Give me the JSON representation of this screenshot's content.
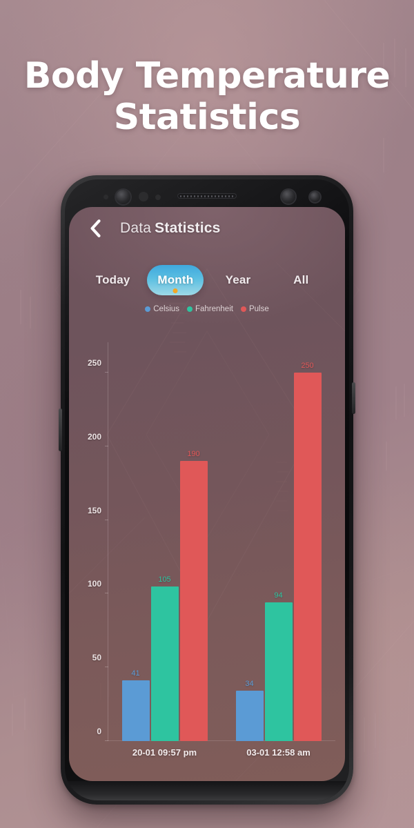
{
  "poster": {
    "title_line1": "Body Temperature",
    "title_line2": "Statistics"
  },
  "app": {
    "header": {
      "back_icon": "chevron-left-icon",
      "title_light": "Data",
      "title_bold": "Statistics"
    },
    "tabs": [
      {
        "label": "Today",
        "active": false
      },
      {
        "label": "Month",
        "active": true
      },
      {
        "label": "Year",
        "active": false
      },
      {
        "label": "All",
        "active": false
      }
    ],
    "legend": [
      {
        "label": "Celsius",
        "color": "#5B9BD5"
      },
      {
        "label": "Fahrenheit",
        "color": "#2EC4A0"
      },
      {
        "label": "Pulse",
        "color": "#E05858"
      }
    ]
  },
  "chart_data": {
    "type": "bar",
    "title": "Data Statistics",
    "xlabel": "",
    "ylabel": "",
    "ylim": [
      0,
      265
    ],
    "yticks": [
      0,
      50,
      100,
      150,
      200,
      250
    ],
    "grid": false,
    "legend_position": "top-center",
    "categories": [
      "20-01 09:57 pm",
      "03-01 12:58 am"
    ],
    "series": [
      {
        "name": "Celsius",
        "color": "#5B9BD5",
        "values": [
          41,
          34
        ]
      },
      {
        "name": "Fahrenheit",
        "color": "#2EC4A0",
        "values": [
          105,
          94
        ]
      },
      {
        "name": "Pulse",
        "color": "#E05858",
        "values": [
          190,
          250
        ]
      }
    ]
  },
  "colors": {
    "background": "#a1838a",
    "screen": "#74565b",
    "accent_tab": "#3FA8DD",
    "accent_dot": "#F2A625",
    "celsius": "#5B9BD5",
    "fahrenheit": "#2EC4A0",
    "pulse": "#E05858"
  }
}
